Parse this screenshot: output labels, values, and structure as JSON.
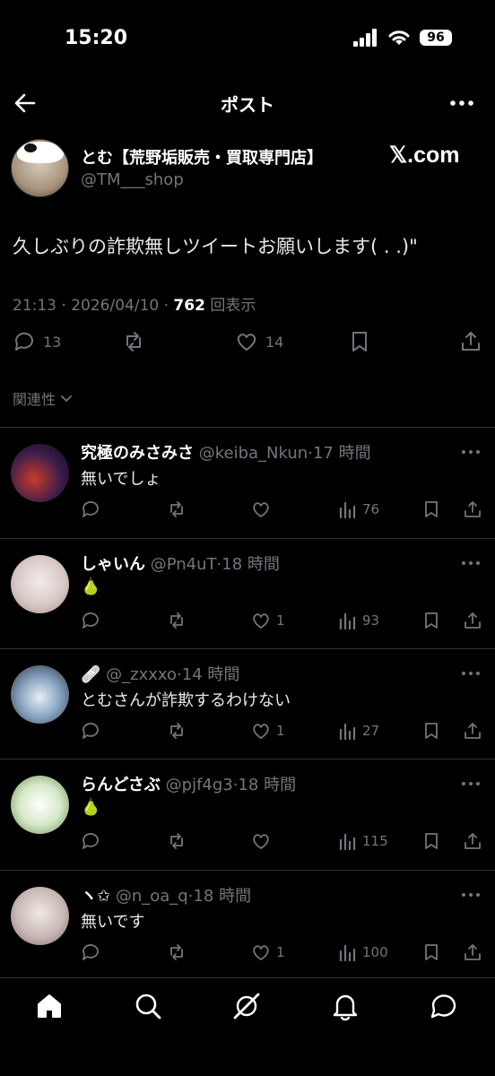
{
  "status_bar": {
    "time": "15:20",
    "battery": "96"
  },
  "header": {
    "title": "ポスト",
    "back_icon": "arrow-left-icon",
    "more_icon": "ellipsis-icon"
  },
  "post": {
    "author_name": "とむ【荒野垢販売・買取専門店】",
    "handle": "@TM___shop",
    "logo": "𝕏.com",
    "text": "久しぶりの詐欺無しツイートお願いします(  . .)\"",
    "time": "21:13",
    "date": "2026/04/10",
    "views": "762",
    "views_label": "回表示",
    "replies": "13",
    "likes": "14"
  },
  "sort": {
    "label": "関連性"
  },
  "replies": [
    {
      "name": "究極のみさみさ",
      "handle": "@keiba_Nkun",
      "time": "17 時間",
      "text": "無いでしょ",
      "likes": "",
      "views": "76"
    },
    {
      "name": "しゃいん",
      "handle": "@Pn4uT",
      "time": "18 時間",
      "text": "🍐",
      "likes": "1",
      "views": "93"
    },
    {
      "name": "🩹",
      "handle": "@_zxxxo",
      "time": "14 時間",
      "text": "とむさんが詐欺するわけない",
      "likes": "1",
      "views": "27"
    },
    {
      "name": "らんどさぶ",
      "handle": "@pjf4g3",
      "time": "18 時間",
      "text": "🍐",
      "likes": "",
      "views": "115"
    },
    {
      "name": "ヽ✩",
      "handle": "@n_oa_q",
      "time": "18 時間",
      "text": "無いです",
      "likes": "1",
      "views": "100"
    }
  ],
  "tabbar": {
    "items": [
      "home-icon",
      "search-icon",
      "grok-icon",
      "notifications-icon",
      "messages-icon"
    ]
  }
}
